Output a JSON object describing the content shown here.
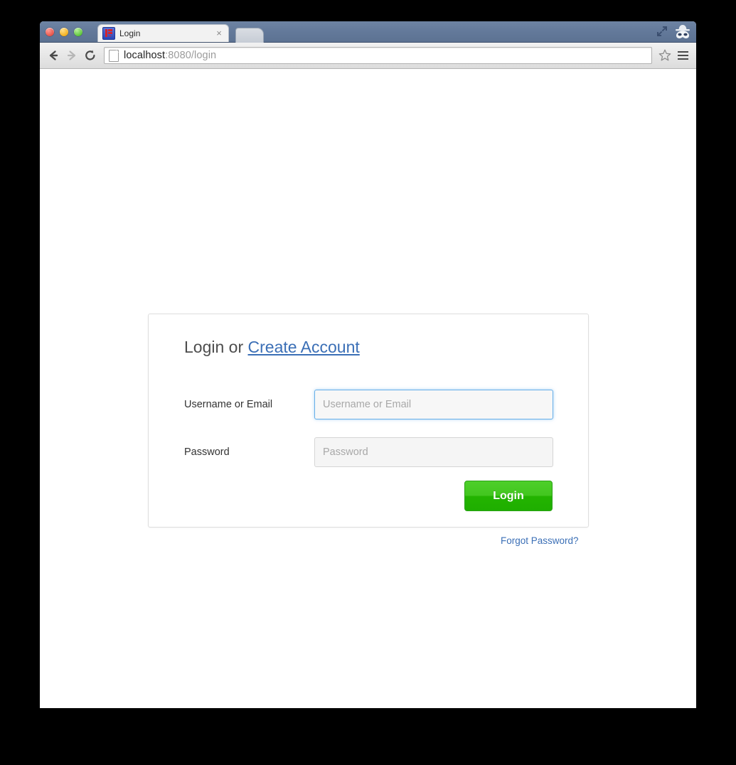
{
  "window": {
    "traffic_lights": [
      "close",
      "minimize",
      "zoom"
    ],
    "tab": {
      "title": "Login",
      "favicon": "jboss-favicon",
      "close_label": "×"
    },
    "new_tab_label": "",
    "right_icons": [
      "fullscreen-icon",
      "incognito-icon"
    ]
  },
  "toolbar": {
    "back_label": "←",
    "forward_label": "→",
    "reload_label": "↻",
    "url_host": "localhost",
    "url_rest": ":8080/login",
    "url_full": "localhost:8080/login",
    "star_label": "☆",
    "menu_label": "≡"
  },
  "login": {
    "heading_prefix": "Login or ",
    "heading_link": "Create Account",
    "username": {
      "label": "Username or Email",
      "placeholder": "Username or Email",
      "value": ""
    },
    "password": {
      "label": "Password",
      "placeholder": "Password",
      "value": ""
    },
    "submit_label": "Login",
    "forgot_label": "Forgot Password?"
  },
  "colors": {
    "link_blue": "#3b6fb6",
    "focus_blue": "#66afe9",
    "button_green": "#23b400",
    "card_border": "#dedede",
    "input_bg": "#f5f5f5",
    "chrome_blue": "#63799a"
  }
}
